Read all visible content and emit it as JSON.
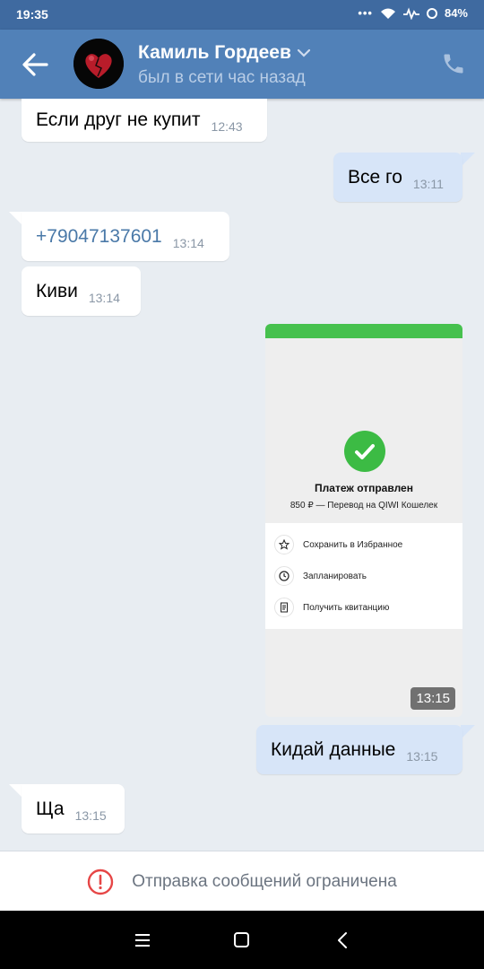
{
  "status_bar": {
    "time": "19:35",
    "battery": "84%"
  },
  "header": {
    "contact_name": "Камиль Гордеев",
    "contact_status": "был в сети час назад"
  },
  "messages": [
    {
      "direction": "in",
      "text": "Если друг не купит",
      "time": "12:43"
    },
    {
      "direction": "out",
      "text": "Все го",
      "time": "13:11"
    },
    {
      "direction": "in",
      "text": "+79047137601",
      "time": "13:14",
      "is_link": true
    },
    {
      "direction": "in",
      "text": "Киви",
      "time": "13:14"
    },
    {
      "direction": "out",
      "type": "image",
      "time": "13:15",
      "image": {
        "title": "Платеж отправлен",
        "subtitle": "850 ₽ — Перевод на QIWI Кошелек",
        "menu": [
          {
            "icon": "star-icon",
            "label": "Сохранить в Избранное"
          },
          {
            "icon": "clock-icon",
            "label": "Запланировать"
          },
          {
            "icon": "receipt-icon",
            "label": "Получить квитанцию"
          }
        ]
      }
    },
    {
      "direction": "out",
      "text": "Кидай данные",
      "time": "13:15"
    },
    {
      "direction": "in",
      "text": "Ща",
      "time": "13:15"
    }
  ],
  "restriction": {
    "text": "Отправка сообщений ограничена"
  },
  "colors": {
    "header": "#5181b8",
    "status_bar": "#3f6aa0",
    "chat_bg": "#e8edf2",
    "out_bubble": "#d7e5f8",
    "accent_green": "#3cbb44",
    "warning_red": "#e64646"
  }
}
